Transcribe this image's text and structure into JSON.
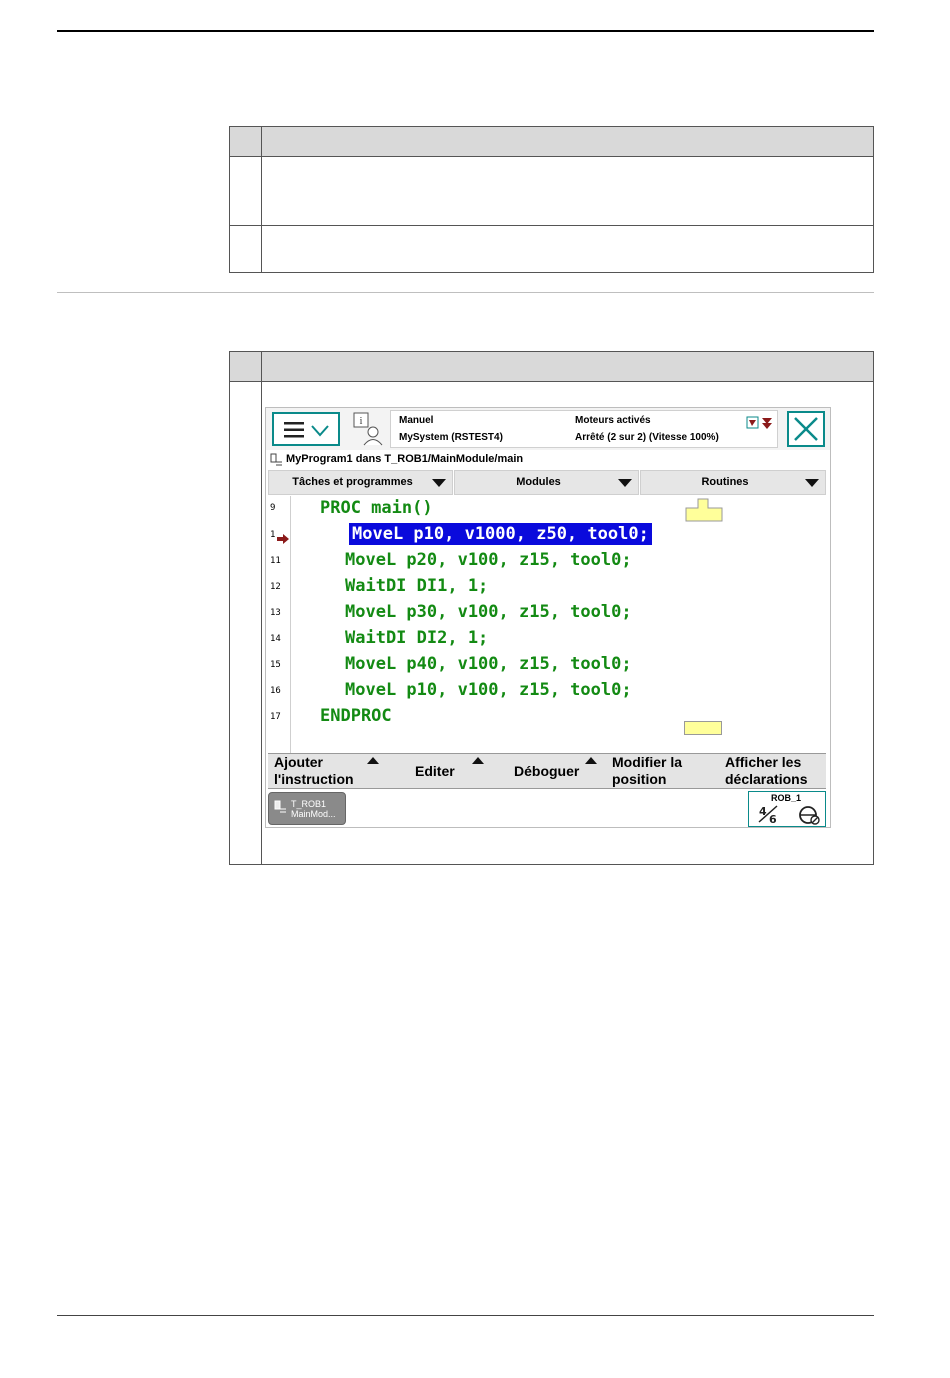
{
  "screen": {
    "status": {
      "mode": "Manuel",
      "system": "MySystem (RSTEST4)",
      "motors": "Moteurs activés",
      "state": "Arrêté (2 sur 2) (Vitesse 100%)"
    },
    "path": "MyProgram1 dans T_ROB1/MainModule/main",
    "dropdowns": [
      "Tâches et programmes",
      "Modules",
      "Routines"
    ],
    "code": [
      {
        "ln": "9",
        "text": "PROC main()"
      },
      {
        "ln": "1",
        "text": "MoveL p10, v1000, z50, tool0;"
      },
      {
        "ln": "11",
        "text": "MoveL p20, v100, z15, tool0;"
      },
      {
        "ln": "12",
        "text": "WaitDI DI1, 1;"
      },
      {
        "ln": "13",
        "text": "MoveL p30, v100, z15, tool0;"
      },
      {
        "ln": "14",
        "text": "WaitDI DI2, 1;"
      },
      {
        "ln": "15",
        "text": "MoveL p40, v100, z15, tool0;"
      },
      {
        "ln": "16",
        "text": "MoveL p10, v100, z15, tool0;"
      },
      {
        "ln": "17",
        "text": "ENDPROC"
      }
    ],
    "bottom_buttons": [
      {
        "line1": "Ajouter",
        "line2": "l'instruction"
      },
      {
        "line1": "Editer",
        "line2": ""
      },
      {
        "line1": "Déboguer",
        "line2": ""
      },
      {
        "line1": "Modifier la",
        "line2": "position"
      },
      {
        "line1": "Afficher les",
        "line2": "déclarations"
      }
    ],
    "task": {
      "line1": "T_ROB1",
      "line2": "MainMod..."
    },
    "rob": {
      "label": "ROB_1",
      "incr": "⅟₆"
    },
    "colors": {
      "accent": "#0a8a8a",
      "code_green": "#138a13",
      "selection": "#0a0adc"
    }
  }
}
